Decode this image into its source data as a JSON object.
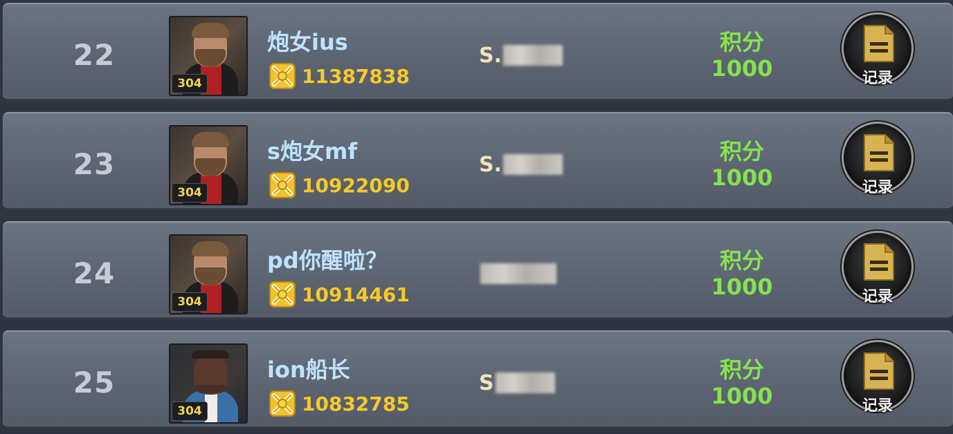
{
  "column": {
    "score_label": "积分",
    "record_label": "记录"
  },
  "colors": {
    "name": "#bfe2ff",
    "power": "#f6c928",
    "score": "#86e24e",
    "rank": "#c6ccd6",
    "level": "#f2d44a"
  },
  "rows": [
    {
      "rank": "22",
      "name": "炮女ius",
      "level": "304",
      "power": "11387838",
      "server_prefix": "S.",
      "score": "1000",
      "avatar_icon": "bearded-man-avatar-icon"
    },
    {
      "rank": "23",
      "name": "s炮女mf",
      "level": "304",
      "power": "10922090",
      "server_prefix": "S.",
      "score": "1000",
      "avatar_icon": "bearded-man-avatar-icon"
    },
    {
      "rank": "24",
      "name": "pd你醒啦？",
      "level": "304",
      "power": "10914461",
      "server_prefix": "",
      "score": "1000",
      "avatar_icon": "bearded-man-avatar-icon"
    },
    {
      "rank": "25",
      "name": "ion船长",
      "level": "304",
      "power": "10832785",
      "server_prefix": "S",
      "score": "1000",
      "avatar_icon": "dark-skinned-man-avatar-icon"
    }
  ]
}
